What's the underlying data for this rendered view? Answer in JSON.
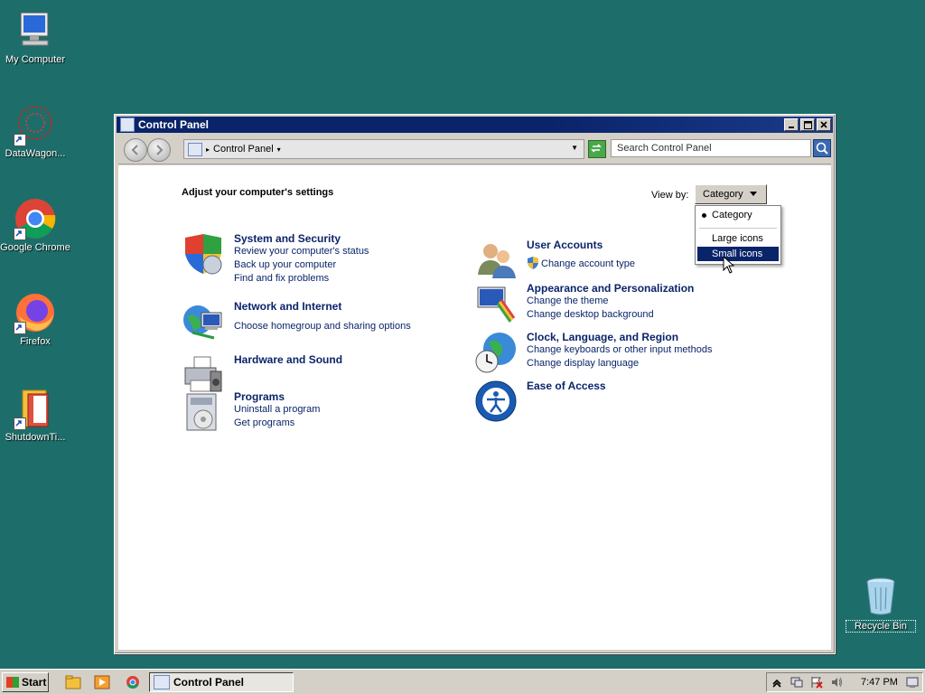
{
  "desktop": {
    "icons": [
      {
        "label": "My Computer",
        "icon": "computer-icon"
      },
      {
        "label": "DataWagon...",
        "icon": "datawagon-icon"
      },
      {
        "label": "Google Chrome",
        "icon": "chrome-icon"
      },
      {
        "label": "Firefox",
        "icon": "firefox-icon"
      },
      {
        "label": "ShutdownTi...",
        "icon": "folder-icon"
      },
      {
        "label": "Recycle Bin",
        "icon": "recycle-bin-icon"
      }
    ]
  },
  "window": {
    "title": "Control Panel",
    "address": "Control Panel",
    "search_placeholder": "Search Control Panel"
  },
  "content": {
    "heading": "Adjust your computer's settings",
    "view_by_label": "View by:",
    "view_by_value": "Category",
    "view_menu": [
      "Category",
      "Large icons",
      "Small icons"
    ],
    "view_menu_selected": "Category",
    "view_menu_hover": "Small icons",
    "categories_left": [
      {
        "title": "System and Security",
        "links": [
          "Review your computer's status",
          "Back up your computer",
          "Find and fix problems"
        ]
      },
      {
        "title": "Network and Internet",
        "links": [
          "Choose homegroup and sharing options"
        ]
      },
      {
        "title": "Hardware and Sound",
        "links": []
      },
      {
        "title": "Programs",
        "links": [
          "Uninstall a program",
          "Get programs"
        ]
      }
    ],
    "categories_right": [
      {
        "title": "User Accounts",
        "links": [
          "Change account type"
        ]
      },
      {
        "title": "Appearance and Personalization",
        "links": [
          "Change the theme",
          "Change desktop background"
        ]
      },
      {
        "title": "Clock, Language, and Region",
        "links": [
          "Change keyboards or other input methods",
          "Change display language"
        ]
      },
      {
        "title": "Ease of Access",
        "links": []
      }
    ]
  },
  "taskbar": {
    "start_label": "Start",
    "task_label": "Control Panel",
    "clock": "7:47 PM"
  },
  "colors": {
    "desktop": "#1d6e6a",
    "titlebar": "#0a246a",
    "link": "#0a246a",
    "menu_highlight": "#0a246a"
  }
}
